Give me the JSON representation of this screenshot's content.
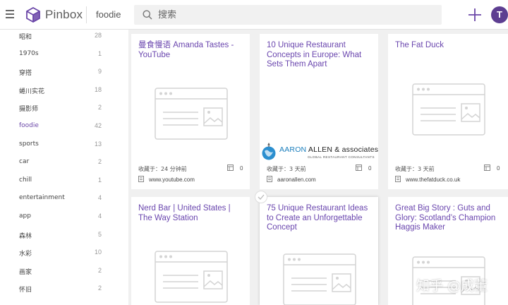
{
  "header": {
    "brand": "Pinbox",
    "collection": "foodie",
    "search_placeholder": "搜索",
    "avatar_initial": "T"
  },
  "sidebar": {
    "items": [
      {
        "label": "昭和",
        "count": "28"
      },
      {
        "label": "1970s",
        "count": "1"
      },
      {
        "label": "穿搭",
        "count": "9"
      },
      {
        "label": "蜷川实花",
        "count": "18"
      },
      {
        "label": "摄影师",
        "count": "2"
      },
      {
        "label": "foodie",
        "count": "42",
        "active": true
      },
      {
        "label": "sports",
        "count": "13"
      },
      {
        "label": "car",
        "count": "2"
      },
      {
        "label": "chill",
        "count": "1"
      },
      {
        "label": "entertainment",
        "count": "4"
      },
      {
        "label": "app",
        "count": "4"
      },
      {
        "label": "森林",
        "count": "5"
      },
      {
        "label": "水彩",
        "count": "10"
      },
      {
        "label": "画家",
        "count": "2"
      },
      {
        "label": "怀旧",
        "count": "2"
      }
    ]
  },
  "cards": [
    {
      "title": "曼食慢语 Amanda Tastes - YouTube",
      "meta": "收藏于：24 分钟前",
      "views": "0",
      "domain": "www.youtube.com"
    },
    {
      "title": "10 Unique Restaurant Concepts in Europe: What Sets Them Apart",
      "meta": "收藏于：3 天前",
      "views": "0",
      "domain": "aaronallen.com",
      "logo_text_a": "AARON",
      "logo_text_b": "ALLEN & associates",
      "logo_sub": "GLOBAL RESTAURANT CONSULTANTS"
    },
    {
      "title": "The Fat Duck",
      "meta": "收藏于：3 天前",
      "views": "0",
      "domain": "www.thefatduck.co.uk"
    },
    {
      "title": "Nerd Bar | United States | The Way Station"
    },
    {
      "title": "75 Unique Restaurant Ideas to Create an Unforgettable Concept"
    },
    {
      "title": "Great Big Story : Guts and Glory: Scotland’s Champion Haggis Maker"
    }
  ],
  "watermark": "知乎 @成董",
  "colors": {
    "accent": "#6a46ae",
    "avatar": "#5d3e91"
  }
}
